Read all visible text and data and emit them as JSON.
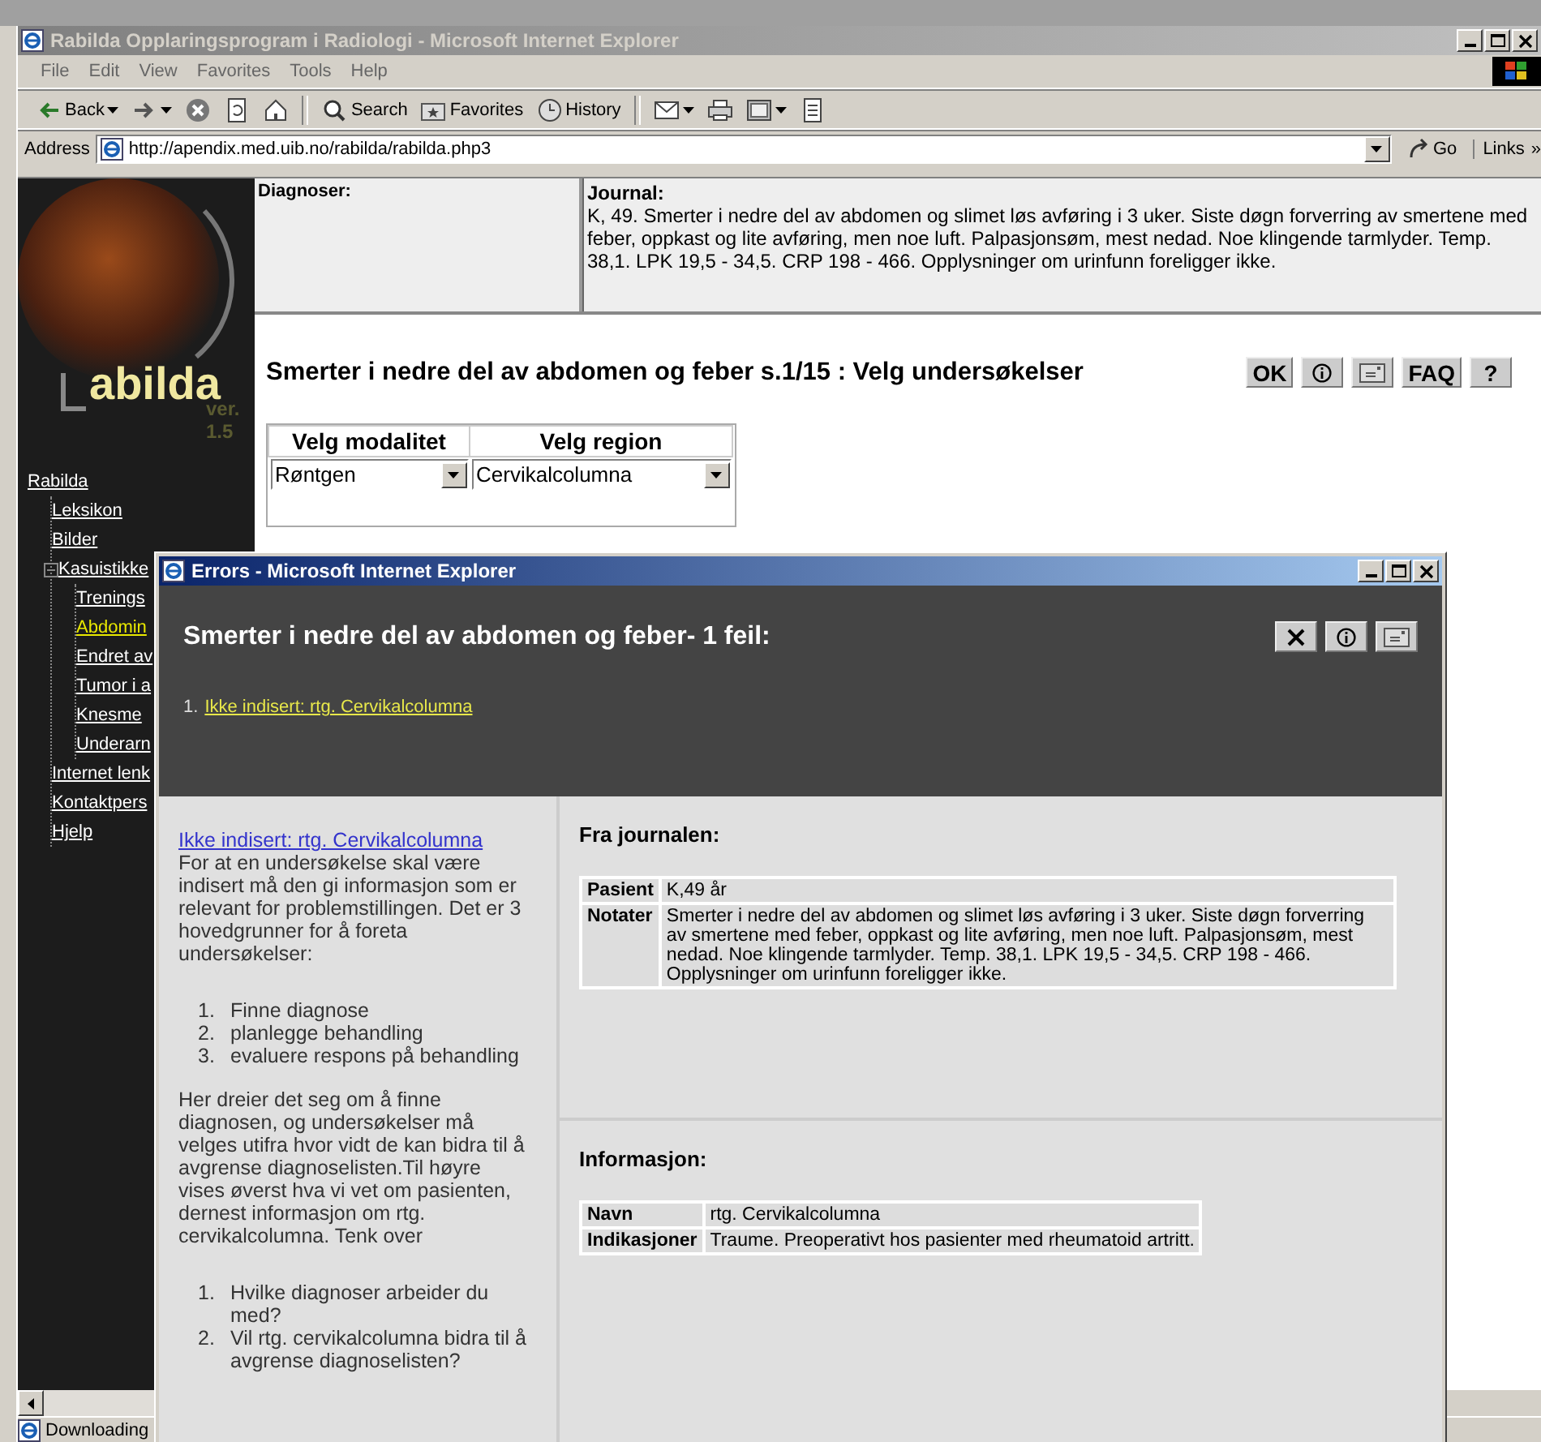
{
  "window": {
    "title": "Rabilda Opplaringsprogram i Radiologi - Microsoft Internet Explorer"
  },
  "menu": [
    "File",
    "Edit",
    "View",
    "Favorites",
    "Tools",
    "Help"
  ],
  "toolbar": [
    {
      "kind": "back",
      "label": "Back",
      "dropdown": true
    },
    {
      "kind": "forward",
      "dropdown": true
    },
    {
      "kind": "stop"
    },
    {
      "kind": "refresh"
    },
    {
      "kind": "home"
    },
    {
      "kind": "separator"
    },
    {
      "kind": "search",
      "label": "Search"
    },
    {
      "kind": "favorites",
      "label": "Favorites"
    },
    {
      "kind": "history",
      "label": "History"
    },
    {
      "kind": "separator"
    },
    {
      "kind": "mail",
      "dropdown": true
    },
    {
      "kind": "print"
    },
    {
      "kind": "window",
      "dropdown": true
    },
    {
      "kind": "document"
    }
  ],
  "address": {
    "label": "Address",
    "value": "http://apendix.med.uib.no/rabilda/rabilda.php3",
    "go": "Go",
    "links": "Links",
    "links_more": "»"
  },
  "sidebar": {
    "logo": "abilda",
    "version": "ver. 1.5",
    "tree": [
      {
        "label": "Rabilda",
        "selected": false,
        "children": [
          {
            "label": "Leksikon",
            "selected": false
          },
          {
            "label": "Bilder",
            "selected": false
          },
          {
            "label": "Kasuistikke",
            "selected": false,
            "expanded": true,
            "children": [
              {
                "label": "Trenings",
                "selected": false
              },
              {
                "label": "Abdomin",
                "selected": true
              },
              {
                "label": "Endret av",
                "selected": false
              },
              {
                "label": "Tumor i a",
                "selected": false
              },
              {
                "label": "Knesme",
                "selected": false
              },
              {
                "label": "Underarn",
                "selected": false
              }
            ]
          },
          {
            "label": "Internet lenk",
            "selected": false
          },
          {
            "label": "Kontaktpers",
            "selected": false
          },
          {
            "label": "Hjelp",
            "selected": false
          }
        ]
      }
    ]
  },
  "diagnoses": {
    "label": "Diagnoser:"
  },
  "journal": {
    "label": "Journal:",
    "text": "K, 49. Smerter i nedre del av abdomen og slimet løs avføring i 3 uker. Siste døgn forverring av smertene med feber, oppkast og lite avføring, men noe luft. Palpasjonsøm, mest nedad. Noe klingende tarmlyder. Temp. 38,1. LPK 19,5 - 34,5. CRP 198 - 466. Opplysninger om urinfunn foreligger ikke."
  },
  "page": {
    "title": "Smerter i nedre del av abdomen og feber s.1/15 : Velg undersøkelser",
    "buttons": [
      {
        "kind": "text",
        "label": "OK"
      },
      {
        "kind": "info"
      },
      {
        "kind": "note"
      },
      {
        "kind": "text",
        "label": "FAQ"
      },
      {
        "kind": "text",
        "label": "?"
      }
    ]
  },
  "selection_table": {
    "columns": [
      "Velg modalitet",
      "Velg region"
    ],
    "values": [
      "Røntgen",
      "Cervikalcolumna"
    ]
  },
  "popup": {
    "title": "Errors - Microsoft Internet Explorer",
    "heading": "Smerter i nedre del av abdomen og feber- 1 feil:",
    "buttons": [
      {
        "kind": "close"
      },
      {
        "kind": "info"
      },
      {
        "kind": "note"
      }
    ],
    "errors": [
      {
        "number": "1.",
        "text": "Ikke indisert: rtg. Cervikalcolumna"
      }
    ],
    "explanation": [
      {
        "kind": "link",
        "text": "Ikke indisert: rtg. Cervikalcolumna"
      },
      {
        "kind": "paragraph",
        "text": "For at en undersøkelse skal være indisert må den gi informasjon som er relevant for problemstillingen. Det er 3 hovedgrunner for å foreta undersøkelser:"
      },
      {
        "kind": "list",
        "items": [
          {
            "number": "1.",
            "text": "Finne diagnose"
          },
          {
            "number": "2.",
            "text": "planlegge behandling"
          },
          {
            "number": "3.",
            "text": "evaluere respons på behandling"
          }
        ]
      },
      {
        "kind": "paragraph",
        "text": "Her dreier det seg om å finne diagnosen, og undersøkelser må velges utifra hvor vidt de kan bidra til å avgrense diagnoselisten.Til høyre vises øverst hva vi vet om pasienten, dernest informasjon om rtg. cervikalcolumna. Tenk over"
      },
      {
        "kind": "list",
        "items": [
          {
            "number": "1.",
            "text": "Hvilke diagnoser arbeider du med?"
          },
          {
            "number": "2.",
            "text": "Vil rtg. cervikalcolumna bidra til å avgrense diagnoselisten?"
          }
        ]
      }
    ],
    "sections": [
      {
        "heading": "Fra journalen:",
        "rows": [
          {
            "label": "Pasient",
            "value": "K,49 år"
          },
          {
            "label": "Notater",
            "value": "Smerter i nedre del av abdomen og slimet løs avføring i 3 uker. Siste døgn forverring av smertene med feber, oppkast og lite avføring, men noe luft. Palpasjonsøm, mest nedad. Noe klingende tarmlyder. Temp. 38,1. LPK 19,5 - 34,5. CRP 198 - 466. Opplysninger om urinfunn foreligger ikke."
          }
        ]
      },
      {
        "heading": "Informasjon:",
        "rows": [
          {
            "label": "Navn",
            "value": "rtg. Cervikalcolumna"
          },
          {
            "label": "Indikasjoner",
            "value": "Traume. Preoperativt hos pasienter med rheumatoid artritt."
          }
        ]
      }
    ]
  },
  "status_bar": {
    "text": "Downloading"
  }
}
